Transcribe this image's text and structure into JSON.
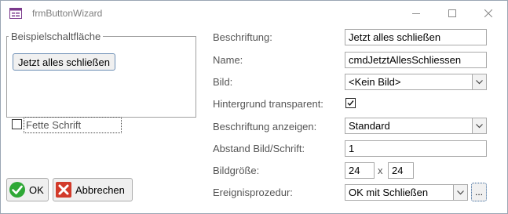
{
  "window": {
    "title": "frmButtonWizard"
  },
  "sample": {
    "legend": "Beispielschaltfläche",
    "button_caption": "Jetzt alles schließen"
  },
  "bold_font": {
    "label": "Fette Schrift",
    "checked": false
  },
  "form": {
    "caption_label": "Beschriftung:",
    "caption_value": "Jetzt alles schließen",
    "name_label": "Name:",
    "name_value": "cmdJetztAllesSchliessen",
    "image_label": "Bild:",
    "image_value": "<Kein Bild>",
    "transparent_label": "Hintergrund transparent:",
    "transparent_checked": true,
    "show_caption_label": "Beschriftung anzeigen:",
    "show_caption_value": "Standard",
    "spacing_label": "Abstand Bild/Schrift:",
    "spacing_value": "1",
    "image_size_label": "Bildgröße:",
    "image_width": "24",
    "size_separator": "x",
    "image_height": "24",
    "event_label": "Ereignisprozedur:",
    "event_value": "OK mit Schließen",
    "ellipsis_label": "..."
  },
  "buttons": {
    "ok": "OK",
    "cancel": "Abbrechen"
  },
  "colors": {
    "ok_icon": "#2fa836",
    "cancel_icon": "#d23a2a",
    "focus_border": "#2f5f96"
  }
}
